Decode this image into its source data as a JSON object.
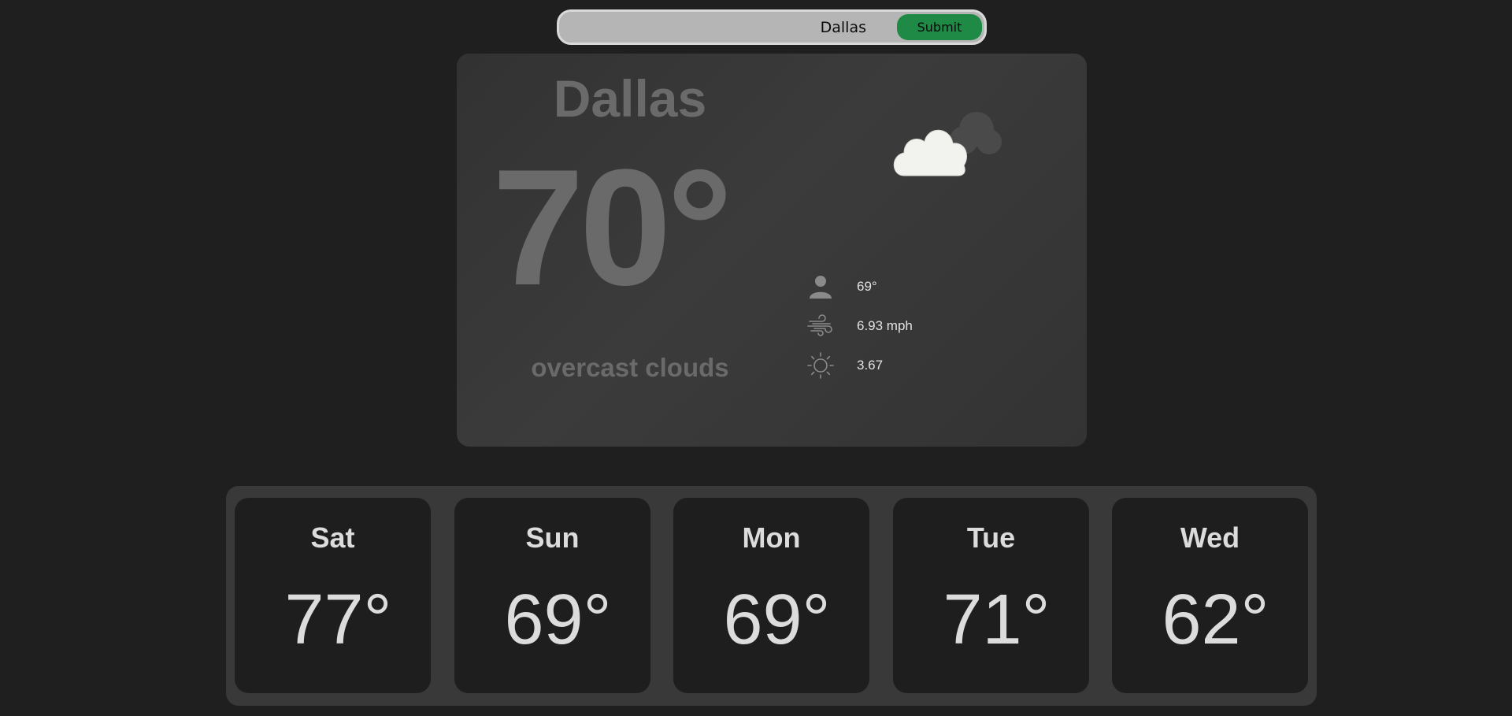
{
  "search": {
    "value": "Dallas",
    "submit_label": "Submit"
  },
  "current": {
    "city": "Dallas",
    "temperature": "70°",
    "description": "overcast clouds",
    "icon": "overcast-clouds-icon",
    "feels_like": "69°",
    "wind_speed": "6.93 mph",
    "uv_index": "3.67"
  },
  "forecast": [
    {
      "day": "Sat",
      "temp": "77°"
    },
    {
      "day": "Sun",
      "temp": "69°"
    },
    {
      "day": "Mon",
      "temp": "69°"
    },
    {
      "day": "Tue",
      "temp": "71°"
    },
    {
      "day": "Wed",
      "temp": "62°"
    }
  ],
  "colors": {
    "background": "#1f1f1f",
    "card": "#363636",
    "submit": "#1f8a45",
    "muted_text": "#6a6a6a",
    "light_text": "#dcdcdc"
  }
}
